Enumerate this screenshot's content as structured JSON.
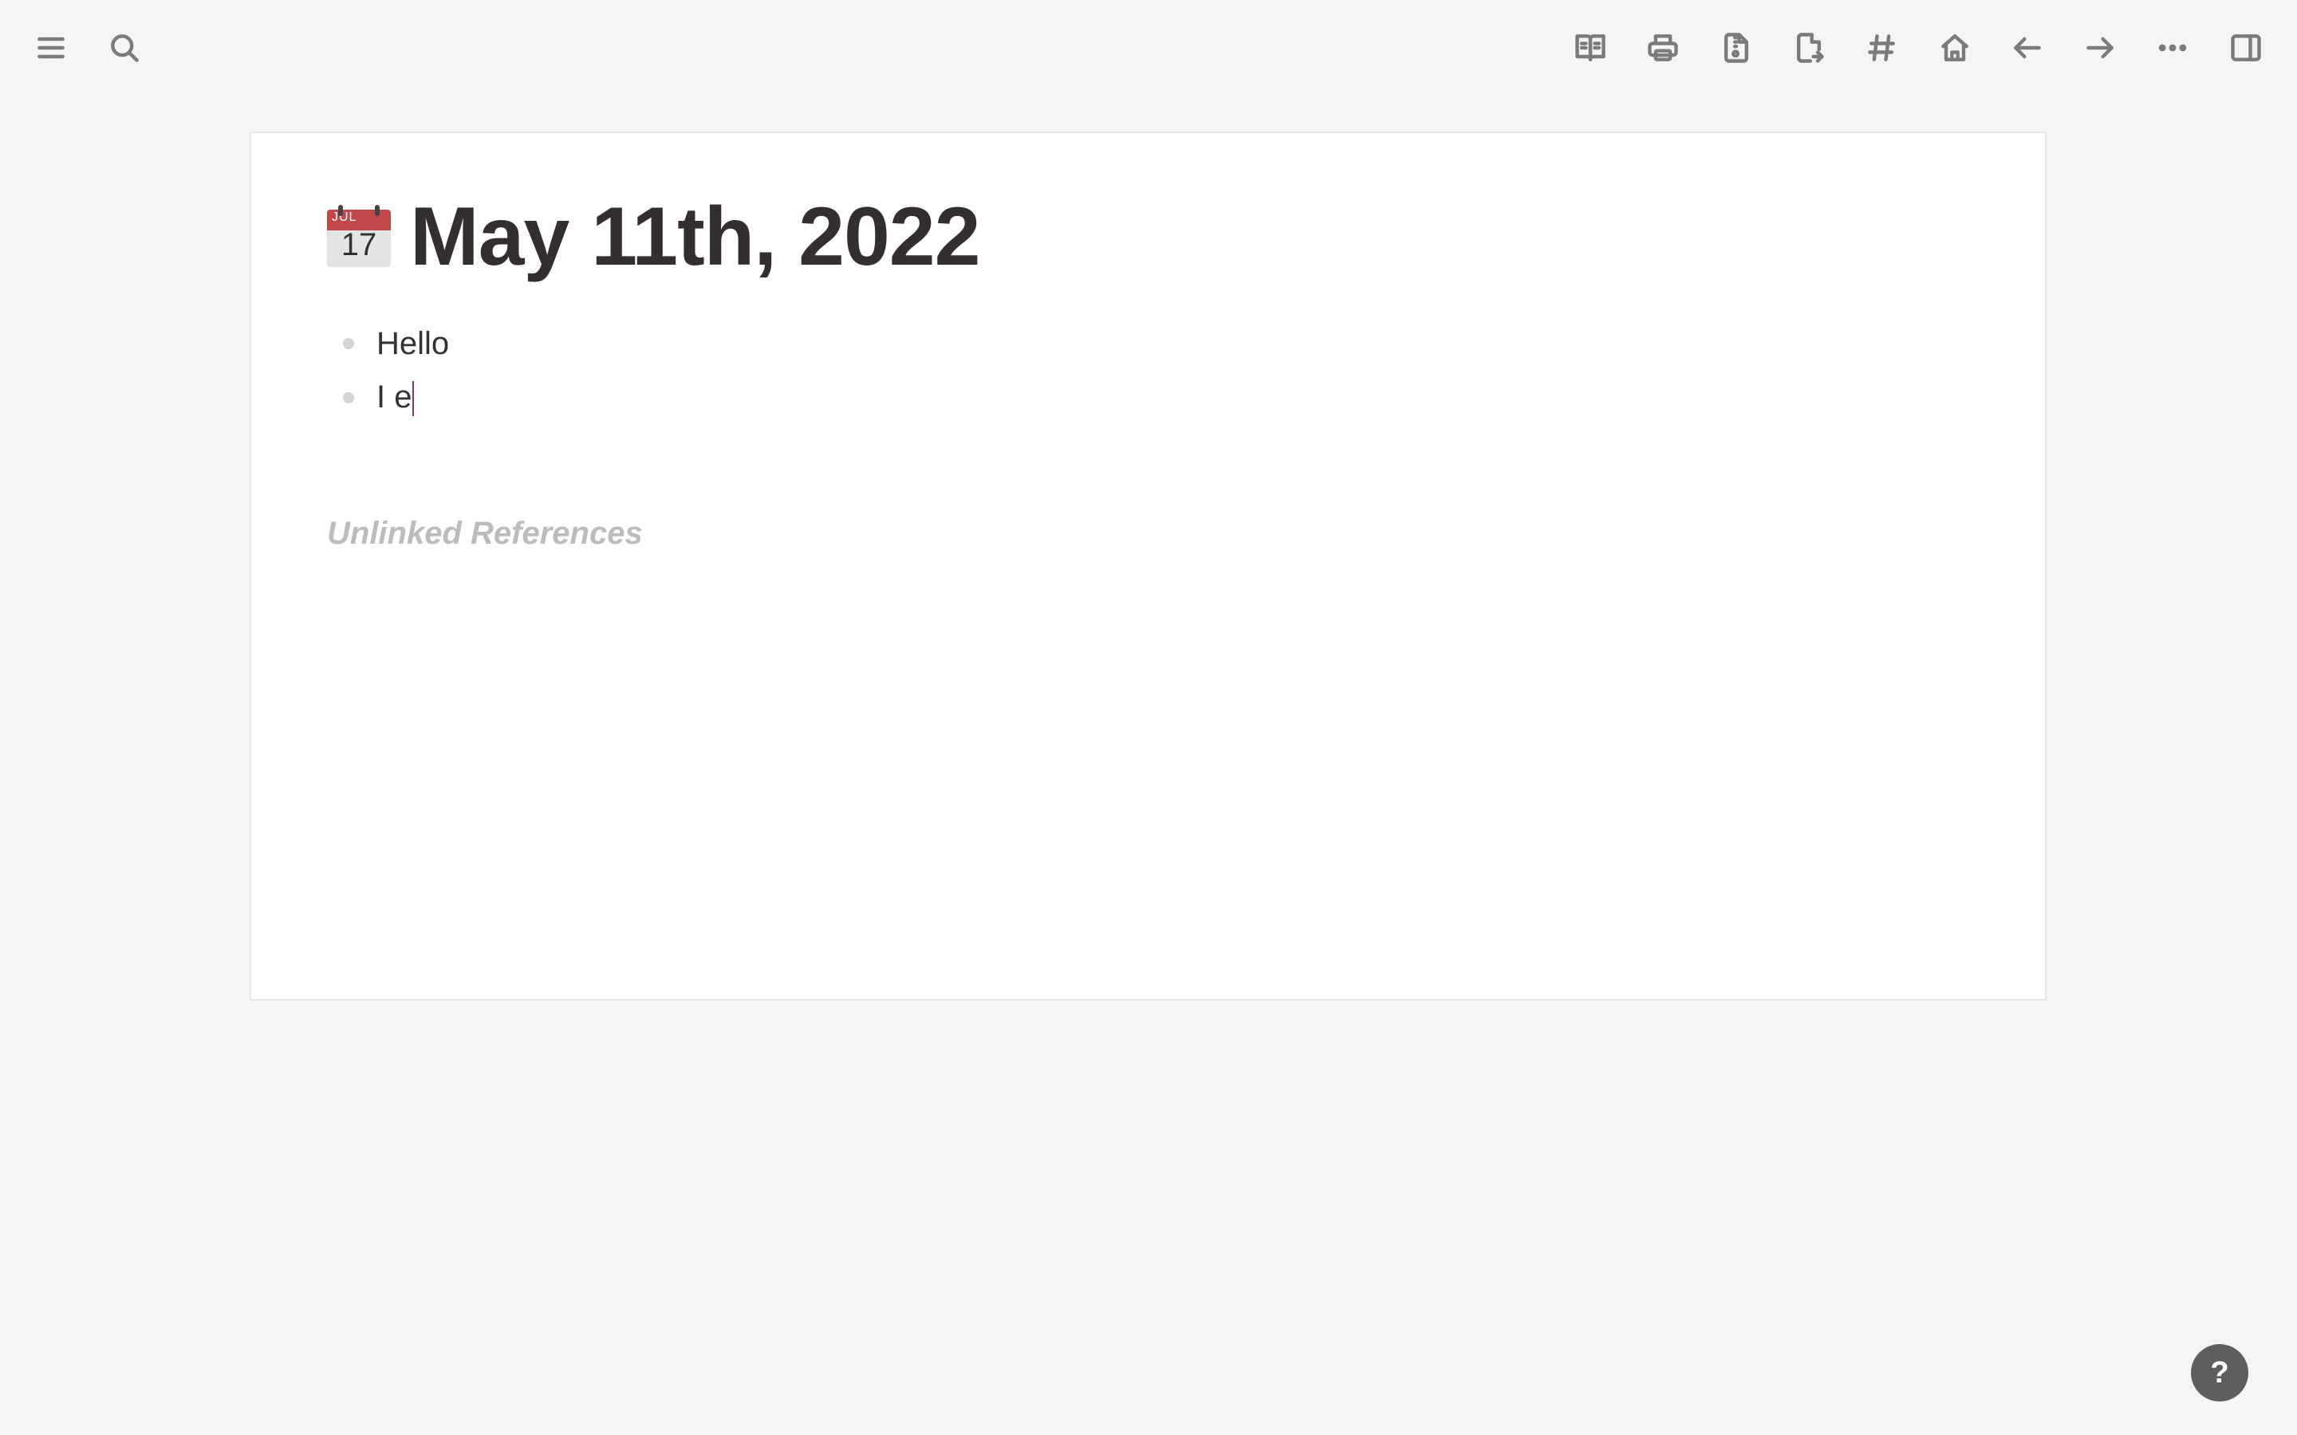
{
  "toolbar": {
    "left_icons": [
      "menu-icon",
      "search-icon"
    ],
    "right_icons": [
      "open-book-icon",
      "print-icon",
      "zip-file-icon",
      "export-file-icon",
      "hash-icon",
      "home-icon",
      "arrow-left-icon",
      "arrow-right-icon",
      "more-icon",
      "sidebar-toggle-icon"
    ]
  },
  "page": {
    "icon": "calendar-emoji",
    "calendar_month": "JUL",
    "calendar_day": "17",
    "title": "May 11th, 2022",
    "blocks": [
      {
        "text": "Hello"
      },
      {
        "text": "I e"
      }
    ],
    "unlinked_references_label": "Unlinked References"
  },
  "help": {
    "label": "?"
  },
  "colors": {
    "background": "#f5f5f5",
    "card": "#ffffff",
    "title": "#342e32",
    "caret": "#8a3b5d",
    "help_button": "#5e5e5e"
  }
}
